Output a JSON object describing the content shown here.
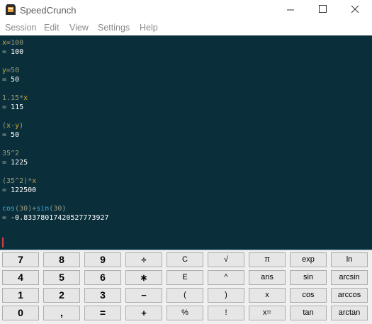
{
  "window": {
    "title": "SpeedCrunch"
  },
  "menu": [
    "Session",
    "Edit",
    "View",
    "Settings",
    "Help"
  ],
  "history": [
    {
      "expr": [
        {
          "t": "x",
          "c": "v"
        },
        {
          "t": "=100",
          "c": "n"
        }
      ],
      "result": "100"
    },
    {
      "expr": [
        {
          "t": "y",
          "c": "v"
        },
        {
          "t": "=50",
          "c": "n"
        }
      ],
      "result": "50"
    },
    {
      "expr": [
        {
          "t": "1.15",
          "c": "n"
        },
        {
          "t": "*",
          "c": "o"
        },
        {
          "t": "x",
          "c": "v"
        }
      ],
      "result": "115"
    },
    {
      "expr": [
        {
          "t": "(",
          "c": "o"
        },
        {
          "t": "x",
          "c": "v"
        },
        {
          "t": "-",
          "c": "o"
        },
        {
          "t": "y",
          "c": "v"
        },
        {
          "t": ")",
          "c": "o"
        }
      ],
      "result": "50"
    },
    {
      "expr": [
        {
          "t": "35^2",
          "c": "n"
        }
      ],
      "result": "1225"
    },
    {
      "expr": [
        {
          "t": "(",
          "c": "o"
        },
        {
          "t": "35^2",
          "c": "n"
        },
        {
          "t": ")",
          "c": "o"
        },
        {
          "t": "*",
          "c": "o"
        },
        {
          "t": "x",
          "c": "v"
        }
      ],
      "result": "122500"
    },
    {
      "expr": [
        {
          "t": "cos",
          "c": "f"
        },
        {
          "t": "(",
          "c": "o"
        },
        {
          "t": "30",
          "c": "n"
        },
        {
          "t": ")",
          "c": "o"
        },
        {
          "t": "+",
          "c": "o"
        },
        {
          "t": "sin",
          "c": "f"
        },
        {
          "t": "(",
          "c": "o"
        },
        {
          "t": "30",
          "c": "n"
        },
        {
          "t": ")",
          "c": "o"
        }
      ],
      "result": "-0.83378017420527773927"
    }
  ],
  "input": {
    "value": ""
  },
  "keypad": [
    [
      "7",
      "8",
      "9",
      "÷",
      "C",
      "√",
      "π",
      "exp",
      "ln"
    ],
    [
      "4",
      "5",
      "6",
      "∗",
      "E",
      "^",
      "ans",
      "sin",
      "arcsin"
    ],
    [
      "1",
      "2",
      "3",
      "−",
      "(",
      ")",
      "x",
      "cos",
      "arccos"
    ],
    [
      "0",
      ",",
      "=",
      "+",
      "%",
      "!",
      "x=",
      "tan",
      "arctan"
    ]
  ],
  "colors": {
    "display_bg": "#0a2f3a",
    "variable": "#d4a62a",
    "number": "#9a9a7c",
    "function": "#3aa6dc",
    "result": "#ffffff",
    "cursor": "#d04040"
  },
  "icons": [
    "speedcrunch-app-icon",
    "minimize-icon",
    "maximize-icon",
    "close-icon"
  ]
}
